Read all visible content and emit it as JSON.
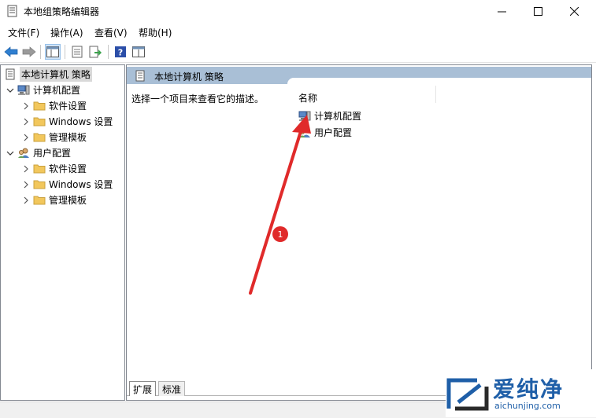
{
  "window": {
    "title": "本地组策略编辑器",
    "min_glyph": "—",
    "max_glyph": "☐",
    "close_glyph": "✕"
  },
  "menu": [
    {
      "label": "文件(F)"
    },
    {
      "label": "操作(A)"
    },
    {
      "label": "查看(V)"
    },
    {
      "label": "帮助(H)"
    }
  ],
  "toolbar": {
    "icons": [
      "back-arrow-icon",
      "forward-arrow-icon",
      "show-tree-icon",
      "properties-icon",
      "export-list-icon",
      "help-icon",
      "extended-view-icon"
    ]
  },
  "tree": {
    "root": "本地计算机 策略",
    "computer": {
      "label": "计算机配置",
      "children": [
        "软件设置",
        "Windows 设置",
        "管理模板"
      ]
    },
    "user": {
      "label": "用户配置",
      "children": [
        "软件设置",
        "Windows 设置",
        "管理模板"
      ]
    }
  },
  "content": {
    "header_title": "本地计算机 策略",
    "description": "选择一个项目来查看它的描述。",
    "column_name": "名称",
    "items": [
      "计算机配置",
      "用户配置"
    ]
  },
  "tabs": [
    {
      "label": "扩展"
    },
    {
      "label": "标准"
    }
  ],
  "annotation": {
    "badge": "1",
    "color": "#e02a2a"
  },
  "watermark": {
    "title": "爱纯净",
    "url": "aichunjing.com"
  },
  "colors": {
    "header_band": "#a9bfd6",
    "selection": "#d9d9d9",
    "folder": "#f2c75c"
  }
}
